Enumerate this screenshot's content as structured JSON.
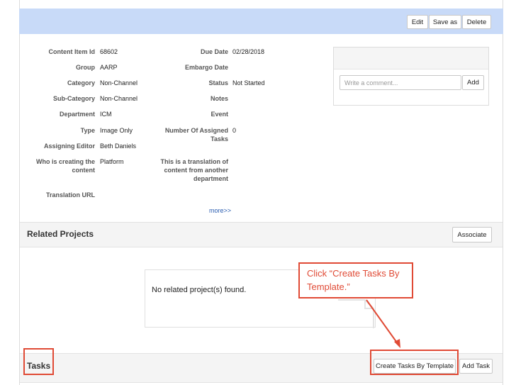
{
  "toolbar": {
    "edit": "Edit",
    "save_as": "Save as",
    "delete": "Delete"
  },
  "details_left": [
    {
      "label": "Content Item Id",
      "value": "68602"
    },
    {
      "label": "Group",
      "value": "AARP"
    },
    {
      "label": "Category",
      "value": "Non-Channel"
    },
    {
      "label": "Sub-Category",
      "value": "Non-Channel"
    },
    {
      "label": "Department",
      "value": "ICM"
    },
    {
      "label": "Type",
      "value": "Image Only"
    },
    {
      "label": "Assigning Editor",
      "value": "Beth Daniels"
    },
    {
      "label": "Who is creating the content",
      "value": "Platform"
    },
    {
      "label": "Translation URL",
      "value": ""
    }
  ],
  "details_right": [
    {
      "label": "Due Date",
      "value": "02/28/2018"
    },
    {
      "label": "Embargo Date",
      "value": ""
    },
    {
      "label": "Status",
      "value": "Not Started"
    },
    {
      "label": "Notes",
      "value": ""
    },
    {
      "label": "Event",
      "value": ""
    },
    {
      "label": "Number Of Assigned Tasks",
      "value": "0"
    },
    {
      "label": "This is a translation of content from another department",
      "value": ""
    }
  ],
  "more_link": "more>>",
  "comment": {
    "placeholder": "Write a comment...",
    "add": "Add"
  },
  "related_projects": {
    "title": "Related Projects",
    "associate": "Associate",
    "empty": "No related project(s) found."
  },
  "tasks": {
    "title": "Tasks",
    "create_by_template": "Create Tasks By Template",
    "add_task": "Add Task"
  },
  "annotation": {
    "text": "Click “Create Tasks By Template.”",
    "color": "#e04a35"
  }
}
